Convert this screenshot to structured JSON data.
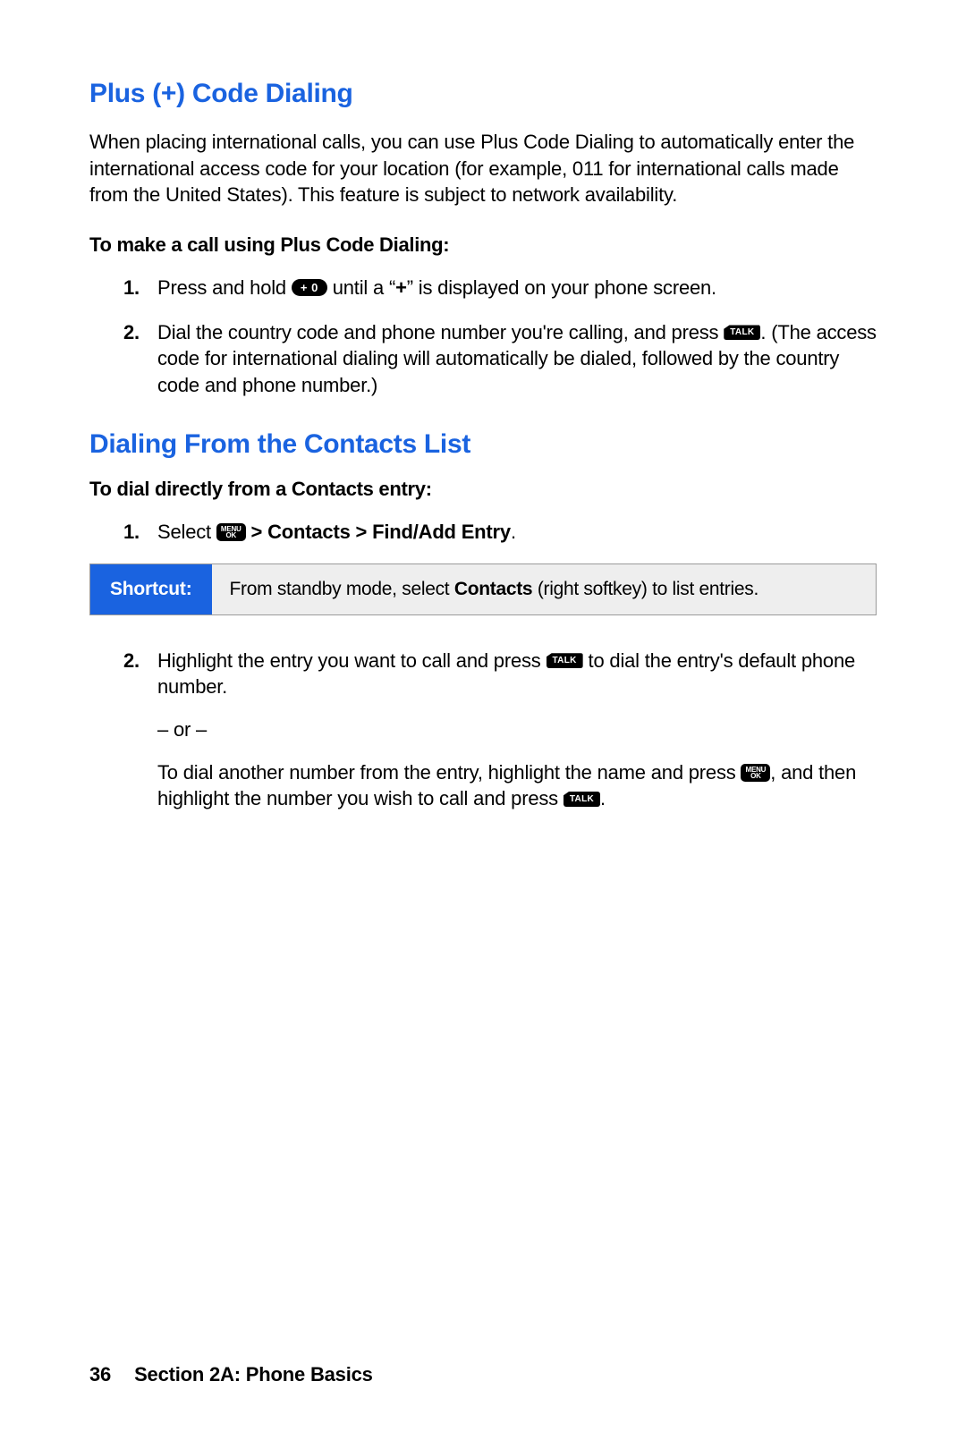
{
  "section1": {
    "heading": "Plus (+) Code Dialing",
    "intro": "When placing international calls, you can use Plus Code Dialing to automatically enter the international access code for your location (for example, 011 for international calls made from the United States). This feature is subject to network availability.",
    "subhead": "To make a call using Plus Code Dialing:",
    "step1_num": "1.",
    "step1_a": "Press and hold ",
    "step1_key": "+  0",
    "step1_b": " until a “",
    "step1_plus": "+",
    "step1_c": "” is displayed on your phone screen.",
    "step2_num": "2.",
    "step2_a": "Dial the country code and phone number you're calling, and press ",
    "step2_key": "TALK",
    "step2_b": ". (The access code for international dialing will automatically be dialed, followed by the country code and phone number.)"
  },
  "section2": {
    "heading": "Dialing From the Contacts List",
    "subhead": "To dial directly from a Contacts entry:",
    "step1_num": "1.",
    "step1_a": "Select ",
    "menu_l1": "MENU",
    "menu_l2": "OK",
    "step1_b": " > Contacts > Find/Add Entry",
    "step1_c": ".",
    "shortcut_label": "Shortcut:",
    "shortcut_a": "From standby mode, select ",
    "shortcut_b": "Contacts",
    "shortcut_c": " (right softkey) to list entries.",
    "step2_num": "2.",
    "step2_a": "Highlight the entry you want to call and press ",
    "talk": "TALK",
    "step2_b": " to dial the entry's default phone number.",
    "or": "– or –",
    "step2_c": "To dial another number from the entry, highlight the name and press ",
    "step2_d": ", and then highlight the number you wish to call and press ",
    "step2_e": "."
  },
  "footer": {
    "page": "36",
    "title": "Section 2A: Phone Basics"
  }
}
